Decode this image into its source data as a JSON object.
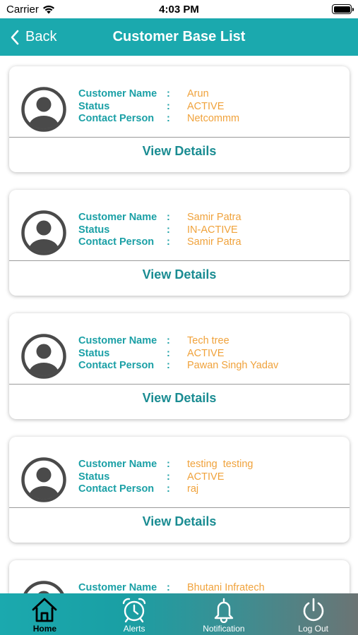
{
  "status_bar": {
    "carrier": "Carrier",
    "time": "4:03 PM"
  },
  "nav": {
    "back_label": "Back",
    "title": "Customer Base List"
  },
  "labels": {
    "customer_name": "Customer Name",
    "status": "Status",
    "contact_person": "Contact Person",
    "colon": ":",
    "view_details": "View Details"
  },
  "customers": [
    {
      "name": "Arun",
      "status": "ACTIVE",
      "contact": "Netcommm"
    },
    {
      "name": "Samir Patra",
      "status": "IN-ACTIVE",
      "contact": "Samir Patra"
    },
    {
      "name": "Tech tree",
      "status": "ACTIVE",
      "contact": "Pawan Singh Yadav"
    },
    {
      "name": "testing  testing",
      "status": "ACTIVE",
      "contact": "raj"
    },
    {
      "name": "Bhutani Infratech",
      "status": "",
      "contact": ""
    }
  ],
  "tabs": [
    {
      "label": "Home",
      "icon": "home-icon",
      "active": true
    },
    {
      "label": "Alerts",
      "icon": "alarm-clock-icon",
      "active": false
    },
    {
      "label": "Notification",
      "icon": "bell-icon",
      "active": false
    },
    {
      "label": "Log Out",
      "icon": "power-icon",
      "active": false
    }
  ],
  "colors": {
    "primary": "#1ba9ae",
    "label_teal": "#1ba0a6",
    "value_orange": "#f0a23b",
    "button_text": "#1a8c92"
  }
}
